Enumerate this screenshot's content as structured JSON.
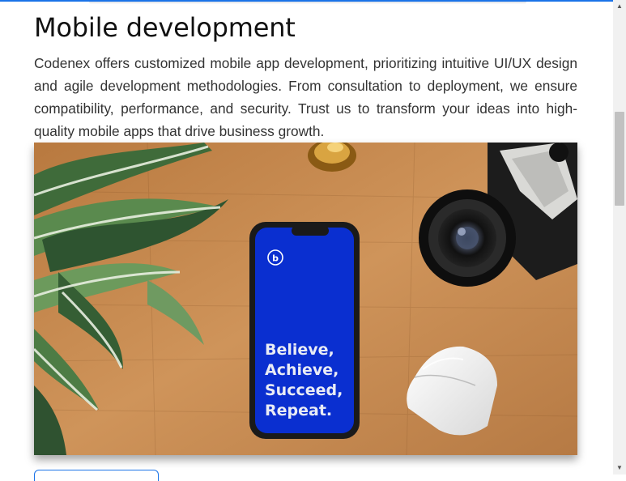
{
  "section": {
    "title": "Mobile development",
    "description": "Codenex offers customized mobile app development, prioritizing intuitive UI/UX design and agile development methodologies. From consultation to deployment, we ensure compatibility, performance, and security. Trust us to transform your ideas into high-quality mobile apps that drive business growth."
  },
  "hero": {
    "phone_screen_lines": [
      "Believe,",
      "Achieve,",
      "Succeed,",
      "Repeat."
    ],
    "phone_logo_letter": "b"
  },
  "colors": {
    "accent": "#1a73e8",
    "phone_screen": "#0a2fd0",
    "desk_wood": "#c98d52"
  },
  "scrollbar": {
    "up_arrow": "▲",
    "down_arrow": "▼"
  }
}
